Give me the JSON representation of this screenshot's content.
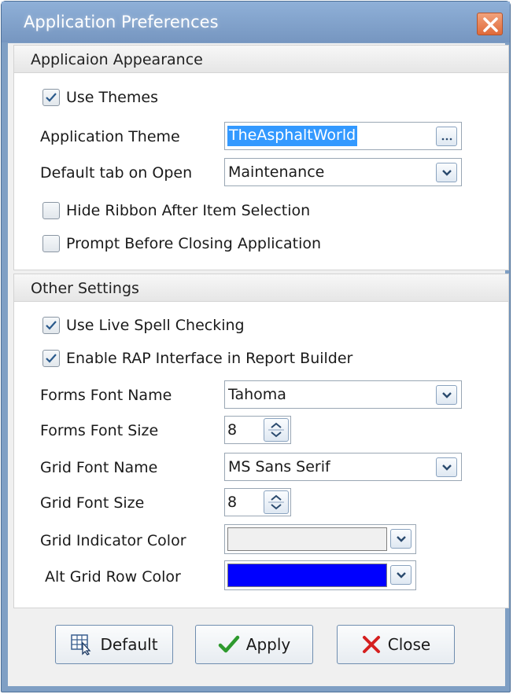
{
  "window": {
    "title": "Application Preferences"
  },
  "appearance": {
    "header": "Applicaion Appearance",
    "use_themes": {
      "label": "Use Themes",
      "checked": true
    },
    "theme": {
      "label": "Application Theme",
      "value": "TheAsphaltWorld"
    },
    "default_tab": {
      "label": "Default tab on Open",
      "value": "Maintenance"
    },
    "hide_ribbon": {
      "label": "Hide Ribbon After Item Selection",
      "checked": false
    },
    "prompt_close": {
      "label": "Prompt Before Closing Application",
      "checked": false
    }
  },
  "other": {
    "header": "Other Settings",
    "spell": {
      "label": "Use Live Spell Checking",
      "checked": true
    },
    "rap": {
      "label": "Enable RAP Interface in Report Builder",
      "checked": true
    },
    "forms_font_name": {
      "label": "Forms Font Name",
      "value": "Tahoma"
    },
    "forms_font_size": {
      "label": "Forms Font Size",
      "value": "8"
    },
    "grid_font_name": {
      "label": "Grid Font Name",
      "value": "MS Sans Serif"
    },
    "grid_font_size": {
      "label": "Grid Font Size",
      "value": "8"
    },
    "grid_indicator": {
      "label": "Grid Indicator Color",
      "color": "#f0f0f0"
    },
    "alt_row": {
      "label": "Alt Grid Row Color",
      "color": "#0000ff"
    }
  },
  "buttons": {
    "default": "Default",
    "apply": "Apply",
    "close": "Close"
  },
  "icons": {
    "close": "close-x-icon",
    "check": "checkmark-icon",
    "dropdown": "chevron-down-icon",
    "ellipsis": "ellipsis-icon",
    "spin": "spin-updown-icon",
    "default": "grid-cursor-icon",
    "apply": "green-check-icon",
    "cancel": "red-x-icon"
  }
}
